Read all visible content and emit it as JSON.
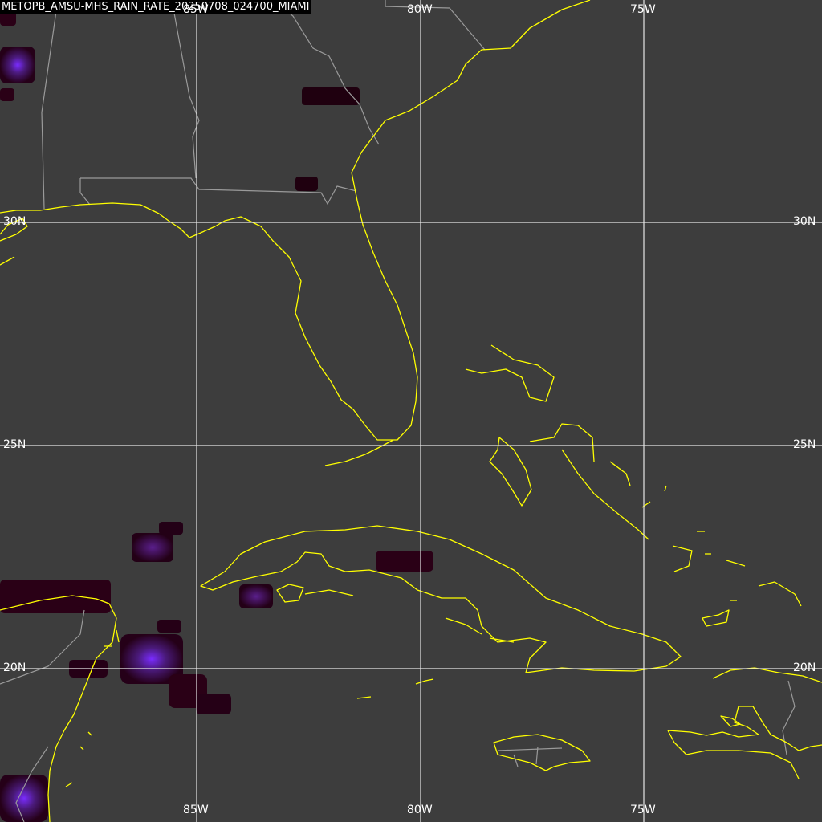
{
  "title": "METOPB_AMSU-MHS_RAIN_RATE_20250708_024700_MIAMI",
  "colors": {
    "background": "#3d3d3d",
    "coastline": "#ffff00",
    "borders": "#a0a0a0",
    "gridlines": "#e6e6e6",
    "labels": "#ffffff",
    "rain_low": "#2a0016",
    "rain_high": "#7a2cff"
  },
  "grid": {
    "longitudes": [
      {
        "label": "85W"
      },
      {
        "label": "80W"
      },
      {
        "label": "75W"
      }
    ],
    "latitudes": [
      {
        "label": "30N"
      },
      {
        "label": "25N"
      },
      {
        "label": "20N"
      }
    ]
  },
  "features": {
    "coastline": "coastline",
    "borders": "state-country-borders",
    "precip": "rain-rate-cells"
  }
}
